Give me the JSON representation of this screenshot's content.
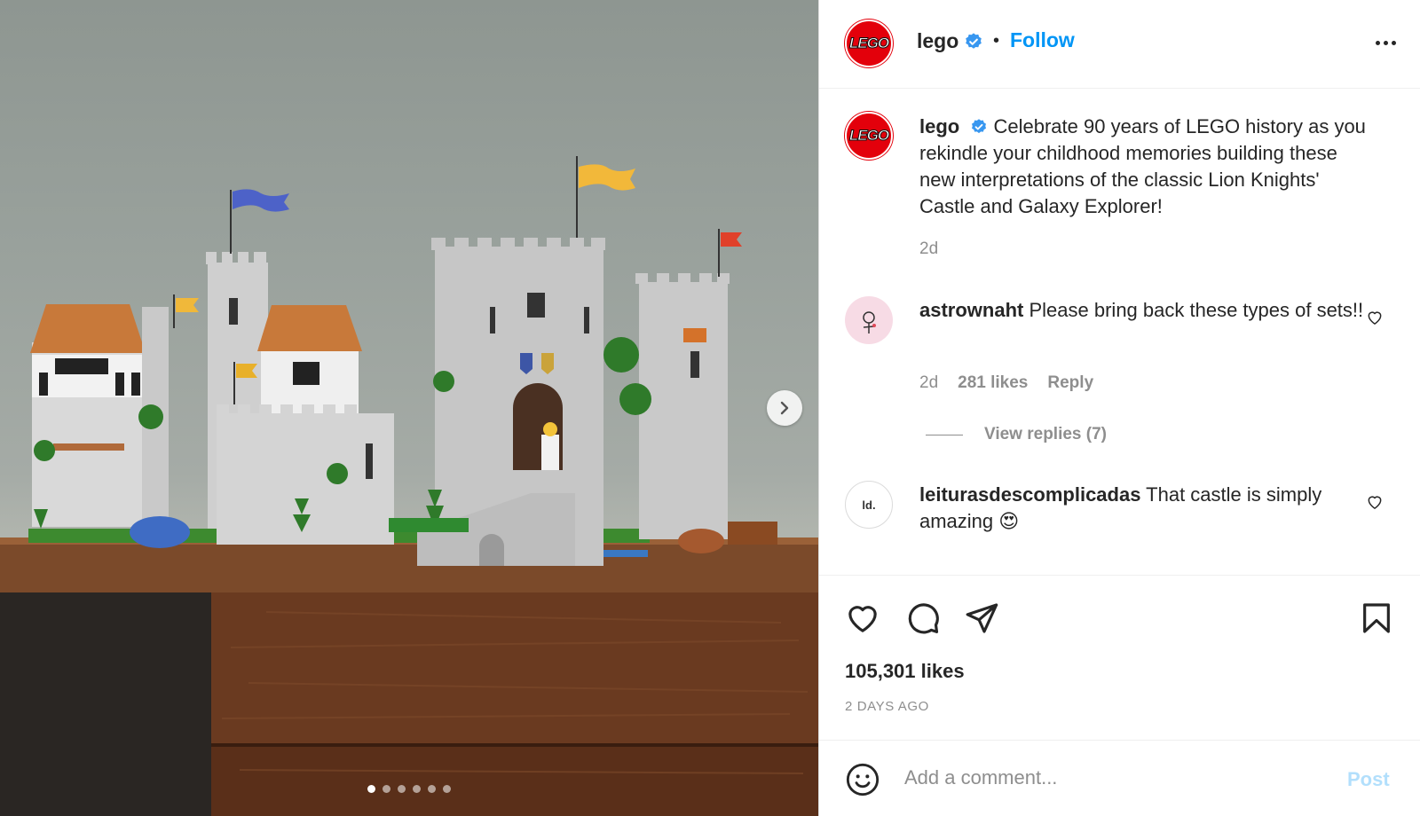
{
  "post": {
    "author": "lego",
    "avatar_text": "LEGO",
    "follow_label": "Follow",
    "separator": "•",
    "caption": "Celebrate 90 years of LEGO history as you rekindle your childhood memories building these new interpretations of the classic Lion Knights' Castle and Galaxy Explorer!",
    "caption_time": "2d",
    "likes": "105,301 likes",
    "posted": "2 DAYS AGO",
    "brand_color": "#e3000b",
    "link_color": "#0095f6"
  },
  "comments": [
    {
      "username": "astrownaht",
      "text": "Please bring back these types of sets!!",
      "time": "2d",
      "likes": "281 likes",
      "reply_label": "Reply",
      "view_replies": "View replies (7)"
    },
    {
      "username": "leiturasdescomplicadas",
      "text": "That castle is simply amazing",
      "emoji": "😍",
      "avatar_text": "ld."
    }
  ],
  "carousel": {
    "slide_count": 6,
    "active_index": 0
  },
  "add_comment": {
    "placeholder": "Add a comment...",
    "post_label": "Post"
  },
  "icons": [
    "verified-badge-icon",
    "more-options-icon",
    "chevron-right-icon",
    "heart-icon",
    "comment-icon",
    "share-icon",
    "bookmark-icon",
    "emoji-icon"
  ]
}
